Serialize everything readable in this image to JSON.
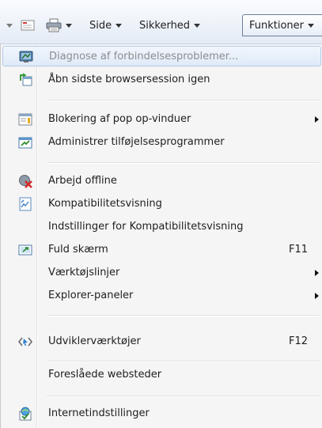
{
  "command_bar": {
    "side_label": "Side",
    "sikkerhed_label": "Sikkerhed",
    "funktioner_label": "Funktioner"
  },
  "menu": {
    "items": [
      {
        "label": "Diagnose af forbindelsesproblemer...",
        "icon": "network-diagnose-icon",
        "disabled": true
      },
      {
        "label": "Åbn sidste browsersession igen",
        "icon": "reopen-session-icon"
      },
      {
        "label": "Blokering af pop op-vinduer",
        "icon": "popup-blocker-icon",
        "submenu": true
      },
      {
        "label": "Administrer tilføjelsesprogrammer",
        "icon": "addons-icon"
      },
      {
        "label": "Arbejd offline",
        "icon": "offline-icon"
      },
      {
        "label": "Kompatibilitetsvisning",
        "icon": "compatibility-view-icon"
      },
      {
        "label": "Indstillinger for Kompatibilitetsvisning"
      },
      {
        "label": "Fuld skærm",
        "icon": "fullscreen-icon",
        "shortcut": "F11"
      },
      {
        "label": "Værktøjslinjer",
        "submenu": true
      },
      {
        "label": "Explorer-paneler",
        "submenu": true
      },
      {
        "label": "Udviklerværktøjer",
        "icon": "developer-tools-icon",
        "shortcut": "F12"
      },
      {
        "label": "Foreslåede websteder"
      },
      {
        "label": "Internetindstillinger",
        "icon": "internet-options-icon"
      }
    ]
  },
  "colors": {
    "menu_bg": "#f5f5f5",
    "highlight_border": "#b6cbe6",
    "disabled_text": "#8d8d8d"
  }
}
